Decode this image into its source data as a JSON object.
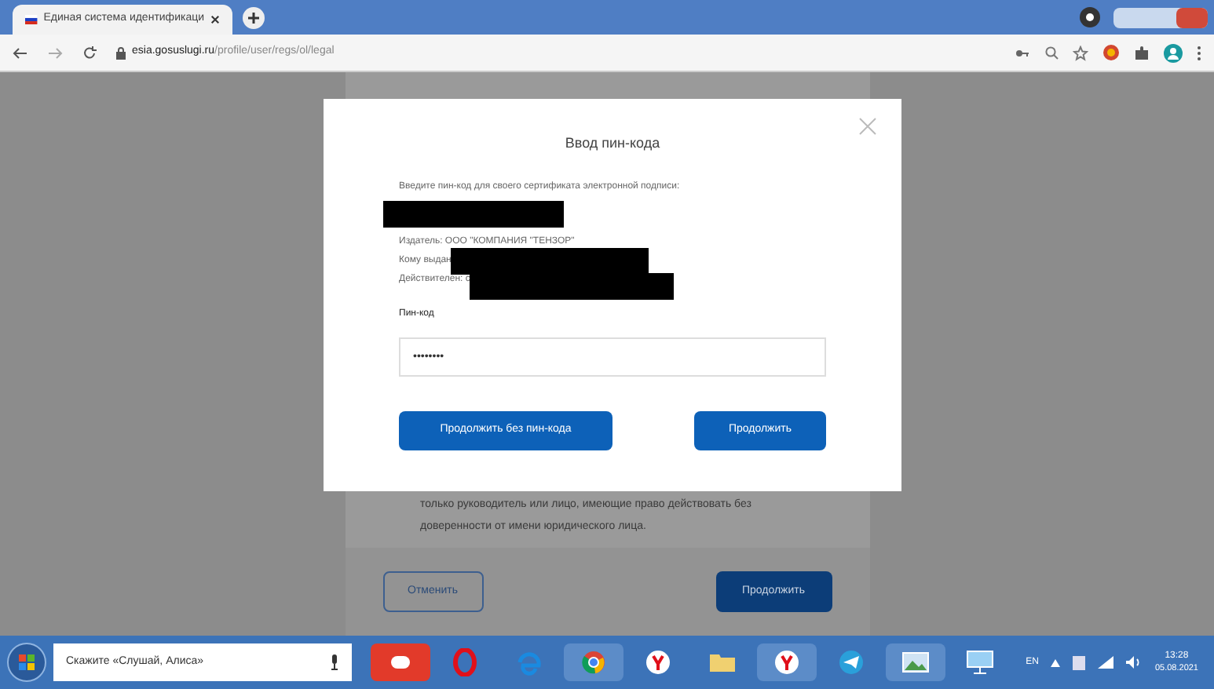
{
  "browser": {
    "tab_title": "Единая система идентификаци",
    "url_host": "esia.gosuslugi.ru",
    "url_path": "/profile/user/regs/ol/legal"
  },
  "background_page": {
    "note_lines": [
      "только руководитель или лицо, имеющие право действовать без",
      "доверенности от имени юридического лица."
    ],
    "cancel_button": "Отменить",
    "continue_button": "Продолжить"
  },
  "dialog": {
    "title": "Ввод пин-кода",
    "intro": "Введите пин-код для своего сертификата электронной подписи:",
    "issuer": "Издатель: ООО \"КОМПАНИЯ \"ТЕНЗОР\"",
    "issued_to": "Кому выдан",
    "valid": "Действителен: с",
    "pin_label": "Пин-код",
    "pin_value": "••••••••",
    "buttons": [
      {
        "label": "Продолжить без пин-кода"
      },
      {
        "label": "Продолжить"
      }
    ]
  },
  "taskbar": {
    "search_placeholder": "Скажите «Слушай, Алиса»",
    "language": "EN",
    "time": "13:28",
    "date": "05.08.2021"
  }
}
